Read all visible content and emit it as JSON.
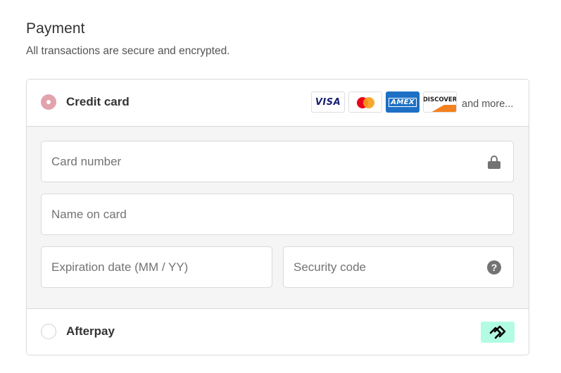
{
  "section": {
    "title": "Payment",
    "subtitle": "All transactions are secure and encrypted."
  },
  "credit_card": {
    "label": "Credit card",
    "selected": true,
    "brands": {
      "visa": "VISA",
      "amex": "AMEX",
      "discover": "DISCOVER"
    },
    "brand_icons": [
      "visa-logo",
      "mastercard-logo",
      "amex-logo",
      "discover-logo"
    ],
    "and_more": "and more..."
  },
  "fields": {
    "card_number": {
      "placeholder": "Card number",
      "icon": "lock-icon"
    },
    "name_on_card": {
      "placeholder": "Name on card"
    },
    "expiration": {
      "placeholder": "Expiration date (MM / YY)"
    },
    "security_code": {
      "placeholder": "Security code",
      "icon": "help-icon"
    }
  },
  "afterpay": {
    "label": "Afterpay",
    "selected": false,
    "logo_icon": "afterpay-logo"
  },
  "colors": {
    "accent_radio": "#e2a3ad",
    "border": "#d9d9d9",
    "form_background": "#f5f5f5",
    "afterpay_mint": "#b2fce4"
  }
}
